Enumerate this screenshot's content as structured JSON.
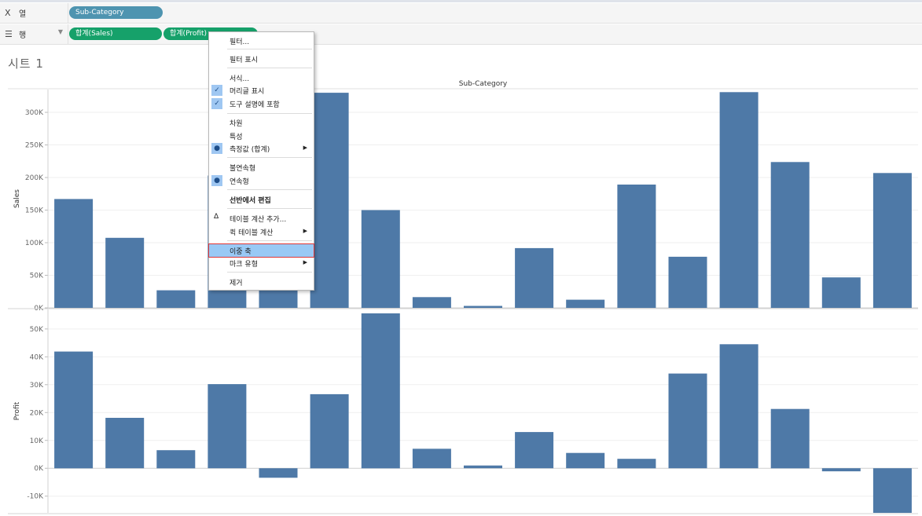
{
  "shelves": {
    "columns": {
      "icon": "columns-icon",
      "label": "열",
      "pill": "Sub-Category"
    },
    "rows": {
      "icon": "rows-icon",
      "label": "행",
      "pills": [
        "합계(Sales)",
        "합계(Profit)"
      ]
    }
  },
  "sheet": {
    "title": "시트 1"
  },
  "context_menu": {
    "items": [
      {
        "label": "필터...",
        "mark": ""
      },
      {
        "label": "필터 표시",
        "mark": ""
      },
      {
        "label": "서식...",
        "mark": ""
      },
      {
        "label": "머리글 표시",
        "mark": "check"
      },
      {
        "label": "도구 설명에 포함",
        "mark": "check"
      },
      {
        "label": "차원",
        "mark": ""
      },
      {
        "label": "특성",
        "mark": ""
      },
      {
        "label": "측정값 (합계)",
        "mark": "bullet",
        "submenu": true
      },
      {
        "label": "불연속형",
        "mark": ""
      },
      {
        "label": "연속형",
        "mark": "bullet"
      },
      {
        "label": "선반에서 편집",
        "mark": "",
        "bold": true
      },
      {
        "label": "테이블 계산 추가...",
        "mark": "delta"
      },
      {
        "label": "퀵 테이블 계산",
        "mark": "",
        "submenu": true
      },
      {
        "label": "이중 축",
        "mark": "",
        "highlighted": true
      },
      {
        "label": "마크 유형",
        "mark": "",
        "submenu": true
      },
      {
        "label": "제거",
        "mark": ""
      }
    ]
  },
  "chart_data": {
    "type": "bar",
    "xlabel": "Sub-Category",
    "bar_color": "#4e79a7",
    "panels": [
      {
        "ylabel": "Sales",
        "ylim": [
          0,
          335000
        ],
        "yticks": [
          0,
          50000,
          100000,
          150000,
          200000,
          250000,
          300000
        ],
        "ytick_labels": [
          "0K",
          "50K",
          "100K",
          "150K",
          "200K",
          "250K",
          "300K"
        ],
        "values": [
          167000,
          107500,
          27000,
          203000,
          114000,
          330000,
          150000,
          16500,
          3000,
          91700,
          12500,
          189200,
          78500,
          331000,
          223800,
          46700,
          206900
        ]
      },
      {
        "ylabel": "Profit",
        "ylim": [
          -16000,
          57000
        ],
        "yticks": [
          -10000,
          0,
          10000,
          20000,
          30000,
          40000,
          50000
        ],
        "ytick_labels": [
          "-10K",
          "0K",
          "10K",
          "20K",
          "30K",
          "40K",
          "50K"
        ],
        "values": [
          41900,
          18100,
          6500,
          30200,
          -3400,
          26600,
          55600,
          7000,
          1000,
          13000,
          5500,
          3400,
          34000,
          44500,
          21300,
          -1100,
          -17700
        ]
      }
    ]
  }
}
